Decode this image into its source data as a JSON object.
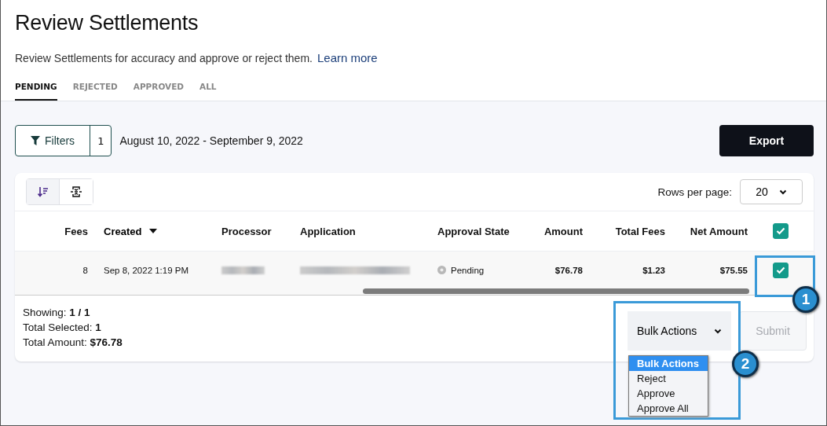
{
  "page": {
    "title": "Review Settlements",
    "description": "Review Settlements for accuracy and approve or reject them.",
    "learn_more": "Learn more"
  },
  "tabs": [
    {
      "label": "PENDING",
      "selected": true
    },
    {
      "label": "REJECTED",
      "selected": false
    },
    {
      "label": "APPROVED",
      "selected": false
    },
    {
      "label": "ALL",
      "selected": false
    }
  ],
  "filters": {
    "label": "Filters",
    "count": "1",
    "date_range": "August 10, 2022 - September 9, 2022"
  },
  "export_button": "Export",
  "toolbar": {
    "rows_per_page_label": "Rows per page:",
    "rows_per_page": "20"
  },
  "table": {
    "columns": [
      {
        "label": "Fees",
        "sorted": false
      },
      {
        "label": "Created",
        "sorted": true
      },
      {
        "label": "Processor",
        "sorted": false
      },
      {
        "label": "Application",
        "sorted": false
      },
      {
        "label": "Approval State",
        "sorted": false
      },
      {
        "label": "Amount",
        "sorted": false
      },
      {
        "label": "Total Fees",
        "sorted": false
      },
      {
        "label": "Net Amount",
        "sorted": false
      }
    ],
    "header_checked": true,
    "rows": [
      {
        "fees": "8",
        "created": "Sep 8, 2022 1:19 PM",
        "processor": {
          "kind": "redacted"
        },
        "application": {
          "kind": "redacted"
        },
        "approval_state": "Pending",
        "amount": "$76.78",
        "total_fees": "$1.23",
        "net_amount": "$75.55",
        "checked": true
      }
    ]
  },
  "summary": [
    {
      "label": "Showing:",
      "value": "1 / 1"
    },
    {
      "label": "Total Selected:",
      "value": "1"
    },
    {
      "label": "Total Amount:",
      "value": "$76.78"
    }
  ],
  "bulk_actions": {
    "label": "Bulk Actions",
    "options": [
      {
        "label": "Bulk Actions",
        "selected": true
      },
      {
        "label": "Reject",
        "selected": false
      },
      {
        "label": "Approve",
        "selected": false
      },
      {
        "label": "Approve All",
        "selected": false
      }
    ]
  },
  "submit_button": {
    "label": "Submit",
    "disabled": true
  },
  "callouts": [
    {
      "number": "1"
    },
    {
      "number": "2"
    }
  ]
}
